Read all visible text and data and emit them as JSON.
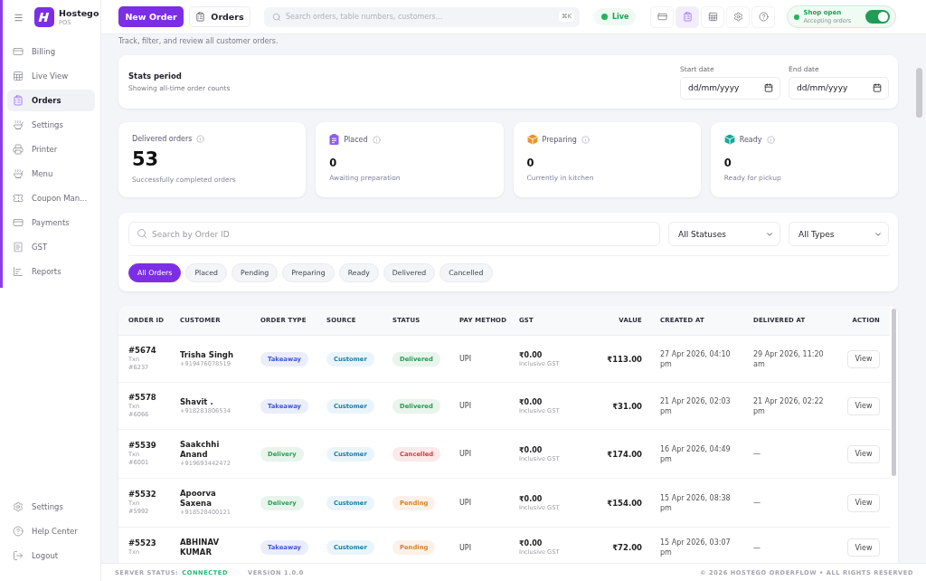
{
  "app": {
    "name": "Hostego",
    "subtitle": "POS"
  },
  "sidebar": {
    "items": [
      {
        "label": "Billing",
        "selected": false
      },
      {
        "label": "Live View",
        "selected": false
      },
      {
        "label": "Orders",
        "selected": true
      },
      {
        "label": "Settings",
        "selected": false
      },
      {
        "label": "Printer",
        "selected": false
      },
      {
        "label": "Menu",
        "selected": false
      },
      {
        "label": "Coupon Man...",
        "selected": false
      },
      {
        "label": "Payments",
        "selected": false
      },
      {
        "label": "GST",
        "selected": false
      },
      {
        "label": "Reports",
        "selected": false
      }
    ],
    "footer_items": [
      {
        "label": "Settings"
      },
      {
        "label": "Help Center"
      },
      {
        "label": "Logout"
      }
    ]
  },
  "top_bar": {
    "new_order_button": "New Order",
    "orders_button": "Orders",
    "search": {
      "placeholder": "Search orders, table numbers, customers...",
      "shortcut": "⌘K"
    },
    "live_status": "Live",
    "icon_buttons": [
      {
        "selected": false
      },
      {
        "selected": true
      },
      {
        "selected": false
      },
      {
        "selected": false
      },
      {
        "selected": false
      }
    ],
    "shop_status": {
      "title": "Shop open",
      "subtitle": "Accepting orders",
      "on": true
    }
  },
  "page": {
    "subtitle": "Track, filter, and review all customer orders."
  },
  "stats_period": {
    "title": "Stats period",
    "description": "Showing all-time order counts",
    "start_date": {
      "label": "Start date",
      "placeholder": "dd/mm/yyyy"
    },
    "end_date": {
      "label": "End date",
      "placeholder": "dd/mm/yyyy"
    }
  },
  "stats": [
    {
      "kind": "headline",
      "label": "Delivered orders",
      "value": "53",
      "description": "Successfully completed orders"
    },
    {
      "kind": "status",
      "label": "Placed",
      "value": "0",
      "description": "Awaiting preparation",
      "color": "#8b5cf6"
    },
    {
      "kind": "status",
      "label": "Preparing",
      "value": "0",
      "description": "Currently in kitchen",
      "color": "#e8952a"
    },
    {
      "kind": "status",
      "label": "Ready",
      "value": "0",
      "description": "Ready for pickup",
      "color": "#17a89a"
    }
  ],
  "filters": {
    "search": {
      "placeholder": "Search by Order ID"
    },
    "status_select": {
      "value": "All Statuses"
    },
    "type_select": {
      "value": "All Types"
    },
    "chips": [
      {
        "label": "All Orders",
        "selected": true
      },
      {
        "label": "Placed",
        "selected": false
      },
      {
        "label": "Pending",
        "selected": false
      },
      {
        "label": "Preparing",
        "selected": false
      },
      {
        "label": "Ready",
        "selected": false
      },
      {
        "label": "Delivered",
        "selected": false
      },
      {
        "label": "Cancelled",
        "selected": false
      }
    ]
  },
  "table": {
    "columns": [
      "ORDER ID",
      "CUSTOMER",
      "ORDER TYPE",
      "SOURCE",
      "STATUS",
      "PAY METHOD",
      "GST",
      "VALUE",
      "CREATED AT",
      "DELIVERED AT",
      "ACTION"
    ],
    "rows": [
      {
        "order_id": "#5674",
        "txn": "Txn #6237",
        "customer": "Trisha Singh",
        "phone": "+919476078519",
        "order_type": {
          "label": "Takeaway",
          "color": "#3f57d4"
        },
        "source": "Customer",
        "status": {
          "label": "Delivered",
          "color": "#2a9a52"
        },
        "pay_method": "UPI",
        "gst": "₹0.00",
        "gst_note": "Inclusive GST",
        "value": "₹113.00",
        "created_at": "27 Apr 2026, 04:10 pm",
        "delivered_at": "29 Apr 2026, 11:20 am",
        "action": "View"
      },
      {
        "order_id": "#5578",
        "txn": "Txn #6066",
        "customer": "Shavit .",
        "phone": "+918283806534",
        "order_type": {
          "label": "Takeaway",
          "color": "#3f57d4"
        },
        "source": "Customer",
        "status": {
          "label": "Delivered",
          "color": "#2a9a52"
        },
        "pay_method": "UPI",
        "gst": "₹0.00",
        "gst_note": "Inclusive GST",
        "value": "₹31.00",
        "created_at": "21 Apr 2026, 02:03 pm",
        "delivered_at": "21 Apr 2026, 02:22 pm",
        "action": "View"
      },
      {
        "order_id": "#5539",
        "txn": "Txn #6001",
        "customer": "Saakchhi Anand",
        "phone": "+919693442472",
        "order_type": {
          "label": "Delivery",
          "color": "#2f9e55"
        },
        "source": "Customer",
        "status": {
          "label": "Cancelled",
          "color": "#d43c3c"
        },
        "pay_method": "UPI",
        "gst": "₹0.00",
        "gst_note": "Inclusive GST",
        "value": "₹174.00",
        "created_at": "16 Apr 2026, 04:49 pm",
        "delivered_at": "—",
        "action": "View"
      },
      {
        "order_id": "#5532",
        "txn": "Txn #5992",
        "customer": "Apoorva Saxena",
        "phone": "+918528400121",
        "order_type": {
          "label": "Delivery",
          "color": "#2f9e55"
        },
        "source": "Customer",
        "status": {
          "label": "Pending",
          "color": "#d9822b"
        },
        "pay_method": "UPI",
        "gst": "₹0.00",
        "gst_note": "Inclusive GST",
        "value": "₹154.00",
        "created_at": "15 Apr 2026, 08:38 pm",
        "delivered_at": "—",
        "action": "View"
      },
      {
        "order_id": "#5523",
        "txn": "Txn",
        "customer": "ABHINAV KUMAR",
        "order_type": {
          "label": "Takeaway",
          "color": "#3f57d4"
        },
        "source": "Customer",
        "status": {
          "label": "Pending",
          "color": "#d9822b"
        },
        "pay_method": "UPI",
        "gst": "₹0.00",
        "gst_note": "Inclusive GST",
        "value": "₹72.00",
        "created_at": "15 Apr 2026, 03:07 pm",
        "delivered_at": "—",
        "action": "View"
      }
    ]
  },
  "status_bar": {
    "server_label": "SERVER STATUS:",
    "server_value": "CONNECTED",
    "version": "VERSION 1.0.0",
    "copyright": "© 2026 HOSTEGO ORDERFLOW • ALL RIGHTS RESERVED"
  }
}
